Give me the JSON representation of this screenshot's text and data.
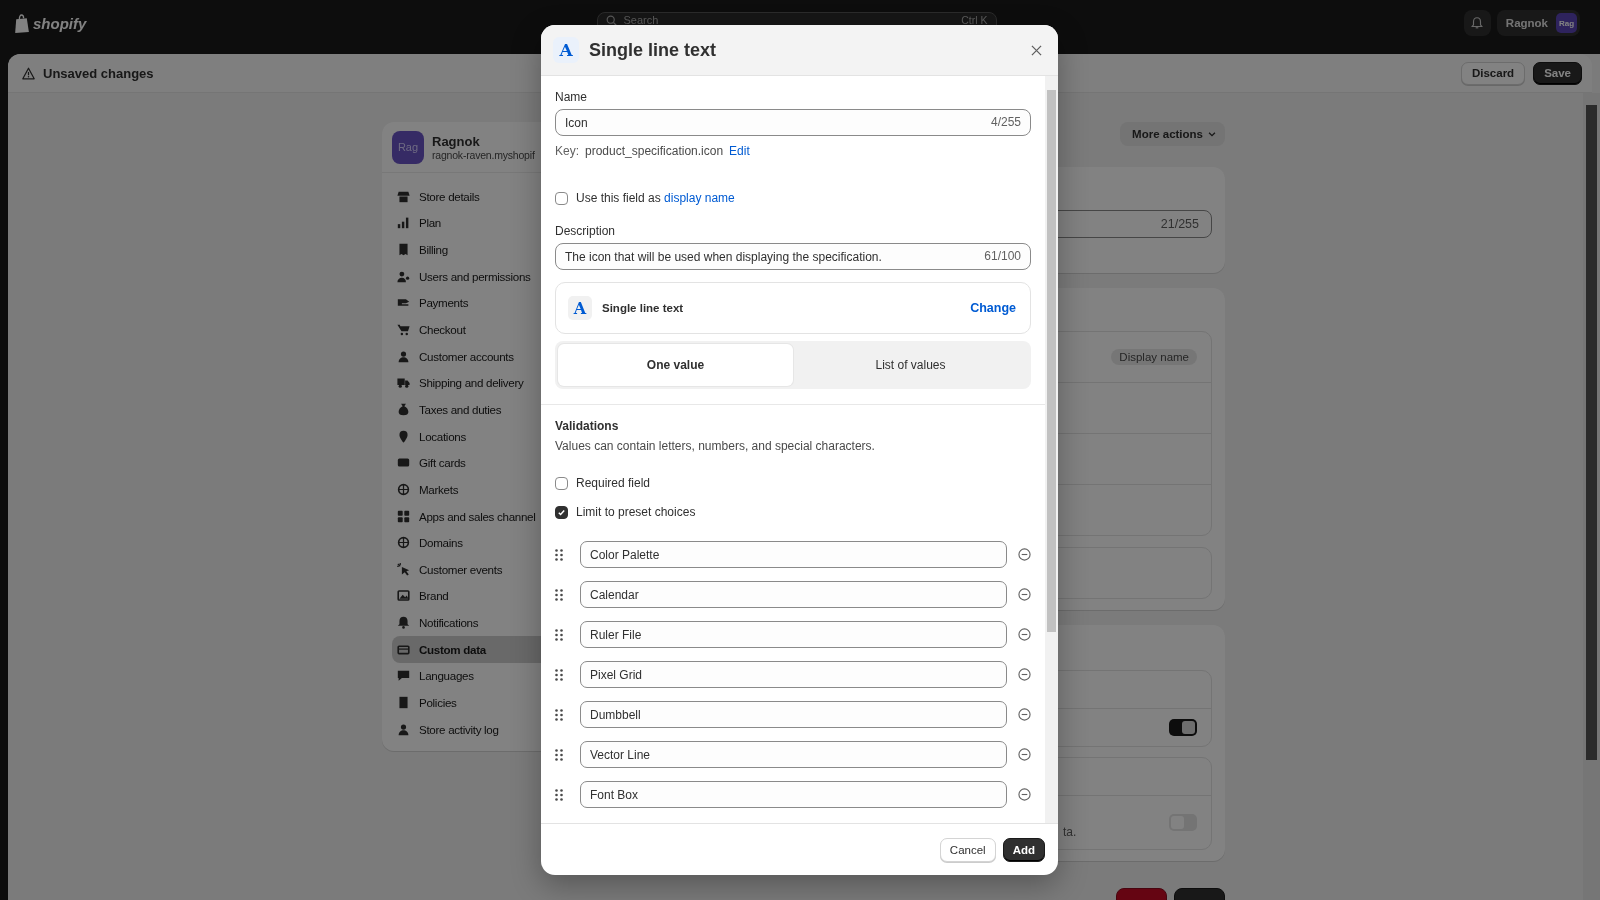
{
  "top_bar": {
    "logo_text": "shopify",
    "search": {
      "placeholder": "Search",
      "shortcut": "Ctrl K"
    },
    "store": {
      "name": "Ragnok",
      "avatar": "Rag"
    }
  },
  "unsaved_bar": {
    "title": "Unsaved changes",
    "buttons": [
      {
        "label": "Discard",
        "kind": "secondary"
      },
      {
        "label": "Save",
        "kind": "primary"
      }
    ]
  },
  "sidebar": {
    "store_name": "Ragnok",
    "store_url": "ragnok-raven.myshopif",
    "avatar": "Rag",
    "items": [
      {
        "label": "Store details",
        "selected": false
      },
      {
        "label": "Plan",
        "selected": false
      },
      {
        "label": "Billing",
        "selected": false
      },
      {
        "label": "Users and permissions",
        "selected": false
      },
      {
        "label": "Payments",
        "selected": false
      },
      {
        "label": "Checkout",
        "selected": false
      },
      {
        "label": "Customer accounts",
        "selected": false
      },
      {
        "label": "Shipping and delivery",
        "selected": false
      },
      {
        "label": "Taxes and duties",
        "selected": false
      },
      {
        "label": "Locations",
        "selected": false
      },
      {
        "label": "Gift cards",
        "selected": false
      },
      {
        "label": "Markets",
        "selected": false
      },
      {
        "label": "Apps and sales channel",
        "selected": false
      },
      {
        "label": "Domains",
        "selected": false
      },
      {
        "label": "Customer events",
        "selected": false
      },
      {
        "label": "Brand",
        "selected": false
      },
      {
        "label": "Notifications",
        "selected": false
      },
      {
        "label": "Custom data",
        "selected": true
      },
      {
        "label": "Languages",
        "selected": false
      },
      {
        "label": "Policies",
        "selected": false
      },
      {
        "label": "Store activity log",
        "selected": false
      }
    ]
  },
  "page": {
    "more_actions": "More actions",
    "name_counter": "21/255",
    "badge": "Display name",
    "toggles": [
      {
        "on": true
      },
      {
        "on": false
      }
    ],
    "partial_text": "ta.",
    "footer_buttons": [
      {
        "kind": "destructive"
      },
      {
        "kind": "primary"
      }
    ]
  },
  "modal": {
    "title_icon": "A",
    "title": "Single line text",
    "name_field": {
      "label": "Name",
      "value": "Icon",
      "counter": "4/255"
    },
    "key": {
      "label": "Key:",
      "value": "product_specification.icon",
      "link": "Edit"
    },
    "display_name_option": {
      "text": "Use this field as",
      "link": "display name",
      "checked": false
    },
    "description_field": {
      "label": "Description",
      "value": "The icon that will be used when displaying the specification.",
      "counter": "61/100"
    },
    "type_card": {
      "icon": "A",
      "label": "Single line text",
      "action": "Change"
    },
    "value_modes": [
      {
        "label": "One value",
        "selected": true
      },
      {
        "label": "List of values",
        "selected": false
      }
    ],
    "validations": {
      "title": "Validations",
      "description": "Values can contain letters, numbers, and special characters.",
      "options": [
        {
          "label": "Required field",
          "checked": false
        },
        {
          "label": "Limit to preset choices",
          "checked": true
        }
      ],
      "choices": [
        "Color Palette",
        "Calendar",
        "Ruler File",
        "Pixel Grid",
        "Dumbbell",
        "Vector Line",
        "Font Box"
      ]
    },
    "buttons": [
      {
        "label": "Cancel",
        "kind": "secondary"
      },
      {
        "label": "Add",
        "kind": "primary"
      }
    ]
  }
}
